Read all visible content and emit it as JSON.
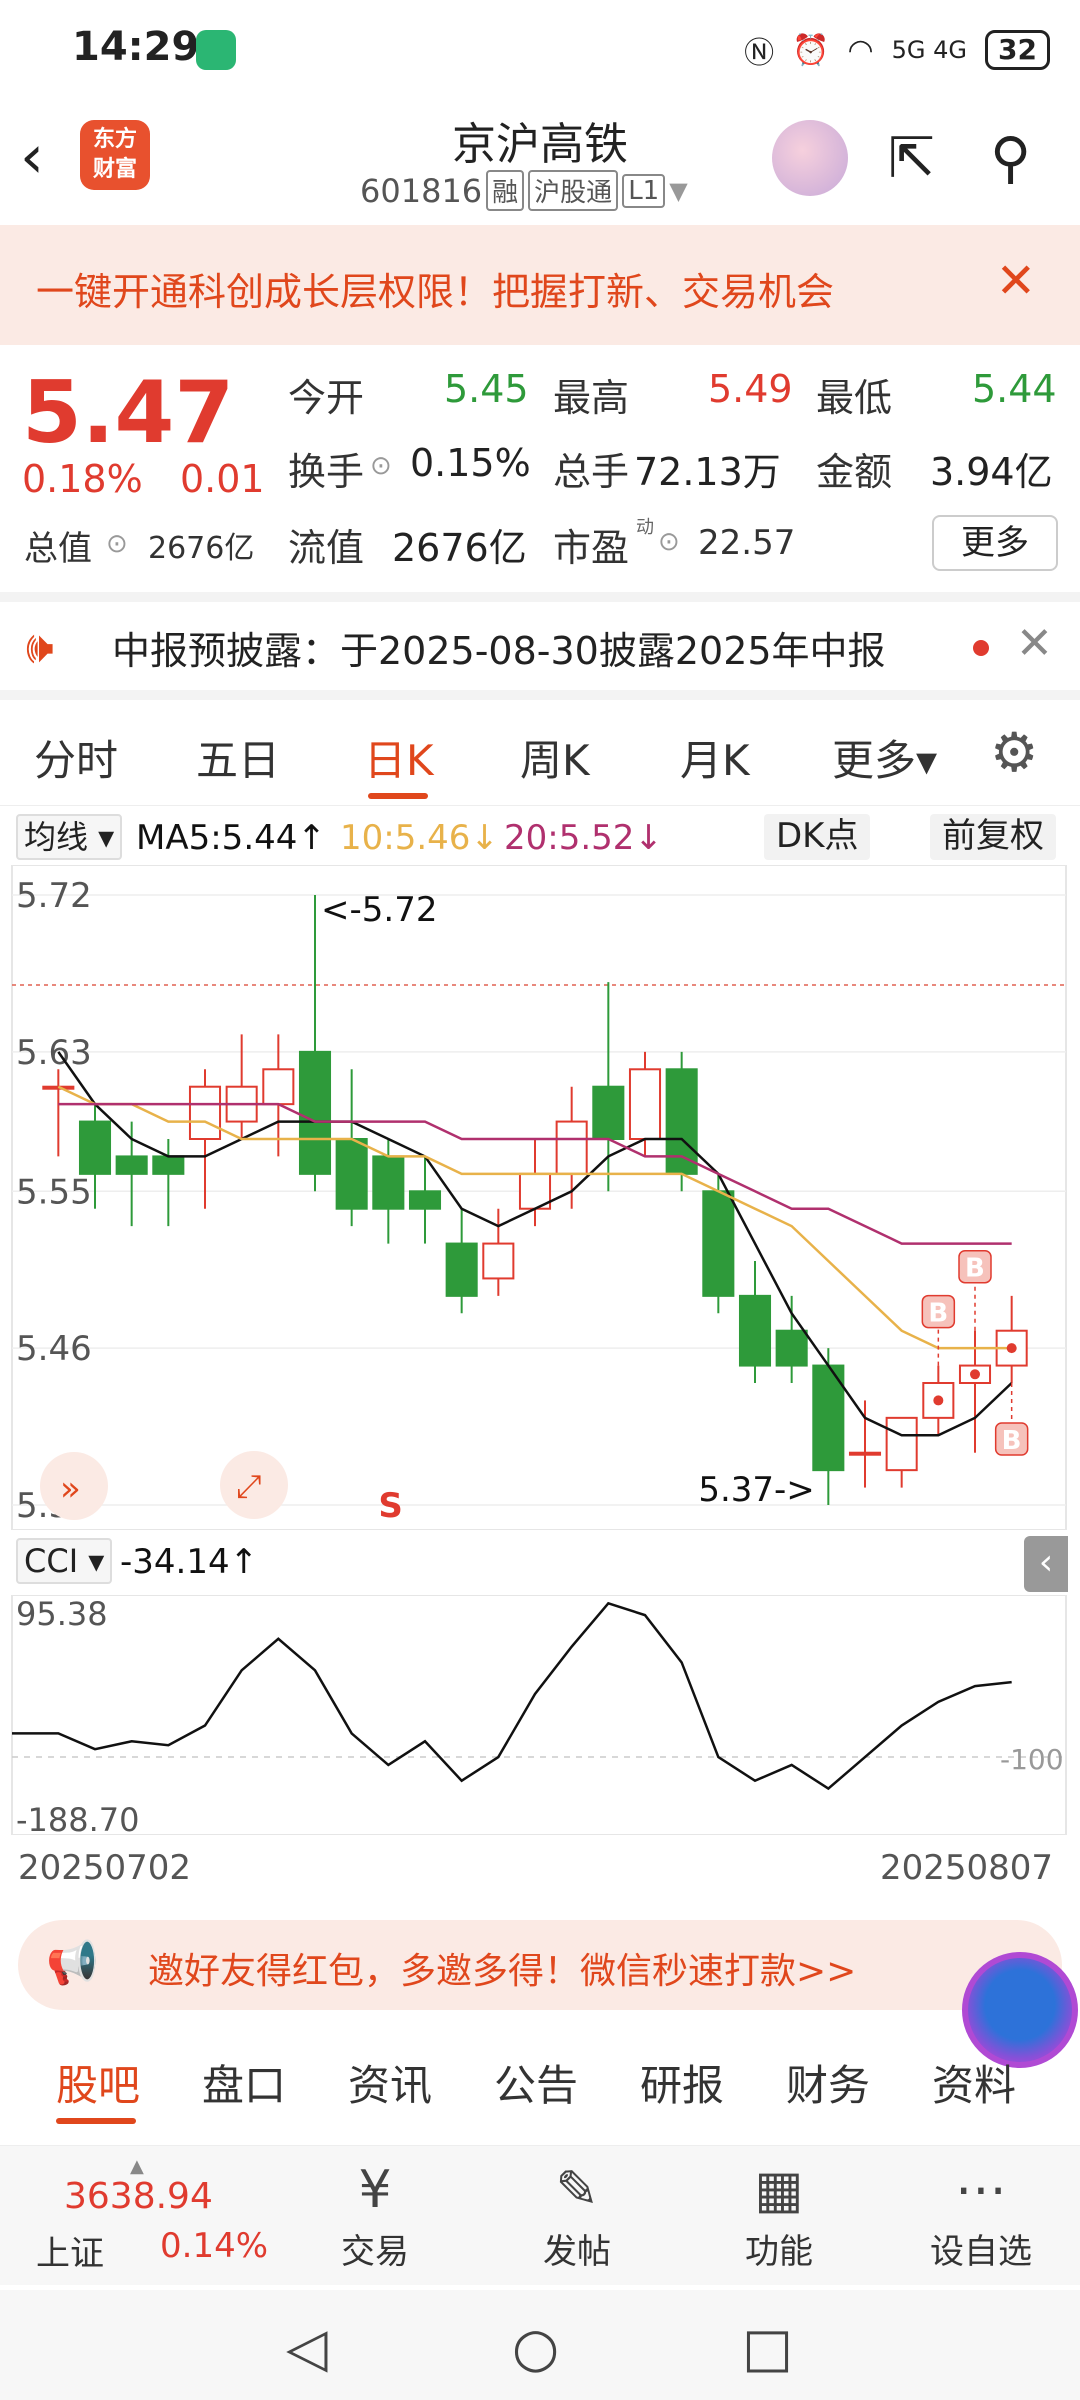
{
  "status_bar": {
    "time": "14:29",
    "network": "5G 4G",
    "battery": "32"
  },
  "header": {
    "logo": "东方\n财富",
    "stock_name": "京沪高铁",
    "stock_code": "601816",
    "tags": [
      "融",
      "沪股通",
      "L1"
    ]
  },
  "promo": {
    "text": "一键开通科创成长层权限！把握打新、交易机会",
    "close": "✕"
  },
  "quote": {
    "price": "5.47",
    "change_pct": "0.18%",
    "change": "0.01",
    "open_label": "今开",
    "open": "5.45",
    "high_label": "最高",
    "high": "5.49",
    "low_label": "最低",
    "low": "5.44",
    "turnover_label": "换手",
    "turnover": "0.15%",
    "volume_label": "总手",
    "volume": "72.13万",
    "amount_label": "金额",
    "amount": "3.94亿",
    "total_mv_label": "总值",
    "total_mv": "2676亿",
    "float_mv_label": "流值",
    "float_mv": "2676亿",
    "pe_label": "市盈",
    "pe_sup": "动",
    "pe": "22.57",
    "more": "更多"
  },
  "notice": {
    "text": "中报预披露：于2025-08-30披露2025年中报",
    "close": "✕"
  },
  "period_tabs": [
    "分时",
    "五日",
    "日K",
    "周K",
    "月K",
    "更多▾"
  ],
  "chart_bar": {
    "ma_select": "均线 ▾",
    "ma5": "MA5:5.44↑",
    "ma10": "10:5.46↓",
    "ma20": "20:5.52↓",
    "dk": "DK点",
    "adjust": "前复权"
  },
  "colors": {
    "up": "#e03b2f",
    "down": "#2e9a3a",
    "accent": "#e0471c",
    "ma5": "#111111",
    "ma10": "#e8b24a",
    "ma20": "#b0306e"
  },
  "chart_data": [
    {
      "type": "candlestick",
      "y_ticks": [
        "5.72",
        "5.63",
        "5.55",
        "5.46",
        "5.37"
      ],
      "ylim": [
        5.37,
        5.72
      ],
      "high_label": "<-5.72",
      "low_label": "5.37->",
      "x_start": "20250702",
      "x_end": "20250807",
      "candles": [
        {
          "o": 5.61,
          "c": 5.61,
          "h": 5.62,
          "l": 5.57
        },
        {
          "o": 5.59,
          "c": 5.56,
          "h": 5.6,
          "l": 5.54
        },
        {
          "o": 5.57,
          "c": 5.56,
          "h": 5.59,
          "l": 5.53
        },
        {
          "o": 5.57,
          "c": 5.56,
          "h": 5.58,
          "l": 5.53
        },
        {
          "o": 5.58,
          "c": 5.61,
          "h": 5.62,
          "l": 5.54
        },
        {
          "o": 5.59,
          "c": 5.61,
          "h": 5.64,
          "l": 5.58
        },
        {
          "o": 5.6,
          "c": 5.62,
          "h": 5.64,
          "l": 5.57
        },
        {
          "o": 5.63,
          "c": 5.56,
          "h": 5.72,
          "l": 5.55
        },
        {
          "o": 5.58,
          "c": 5.54,
          "h": 5.62,
          "l": 5.53
        },
        {
          "o": 5.57,
          "c": 5.54,
          "h": 5.58,
          "l": 5.52
        },
        {
          "o": 5.55,
          "c": 5.54,
          "h": 5.57,
          "l": 5.52
        },
        {
          "o": 5.52,
          "c": 5.49,
          "h": 5.54,
          "l": 5.48
        },
        {
          "o": 5.5,
          "c": 5.52,
          "h": 5.54,
          "l": 5.49
        },
        {
          "o": 5.54,
          "c": 5.56,
          "h": 5.58,
          "l": 5.53
        },
        {
          "o": 5.56,
          "c": 5.59,
          "h": 5.61,
          "l": 5.54
        },
        {
          "o": 5.61,
          "c": 5.58,
          "h": 5.67,
          "l": 5.55
        },
        {
          "o": 5.58,
          "c": 5.62,
          "h": 5.63,
          "l": 5.57
        },
        {
          "o": 5.62,
          "c": 5.56,
          "h": 5.63,
          "l": 5.55
        },
        {
          "o": 5.55,
          "c": 5.49,
          "h": 5.56,
          "l": 5.48
        },
        {
          "o": 5.49,
          "c": 5.45,
          "h": 5.51,
          "l": 5.44
        },
        {
          "o": 5.47,
          "c": 5.45,
          "h": 5.49,
          "l": 5.44
        },
        {
          "o": 5.45,
          "c": 5.39,
          "h": 5.46,
          "l": 5.37
        },
        {
          "o": 5.4,
          "c": 5.4,
          "h": 5.43,
          "l": 5.38
        },
        {
          "o": 5.39,
          "c": 5.42,
          "h": 5.42,
          "l": 5.38
        },
        {
          "o": 5.42,
          "c": 5.44,
          "h": 5.45,
          "l": 5.41
        },
        {
          "o": 5.44,
          "c": 5.45,
          "h": 5.47,
          "l": 5.4
        },
        {
          "o": 5.45,
          "c": 5.47,
          "h": 5.49,
          "l": 5.44
        }
      ],
      "series": [
        {
          "name": "MA5",
          "values": [
            5.63,
            5.6,
            5.58,
            5.57,
            5.57,
            5.58,
            5.59,
            5.59,
            5.59,
            5.58,
            5.57,
            5.54,
            5.53,
            5.54,
            5.55,
            5.57,
            5.58,
            5.58,
            5.56,
            5.52,
            5.48,
            5.45,
            5.42,
            5.41,
            5.41,
            5.42,
            5.44
          ]
        },
        {
          "name": "10",
          "values": [
            5.61,
            5.6,
            5.6,
            5.59,
            5.59,
            5.58,
            5.58,
            5.58,
            5.58,
            5.57,
            5.57,
            5.56,
            5.56,
            5.56,
            5.56,
            5.56,
            5.56,
            5.56,
            5.55,
            5.54,
            5.53,
            5.51,
            5.49,
            5.47,
            5.46,
            5.46,
            5.46
          ]
        },
        {
          "name": "20",
          "values": [
            5.6,
            5.6,
            5.6,
            5.6,
            5.6,
            5.6,
            5.6,
            5.59,
            5.59,
            5.59,
            5.59,
            5.58,
            5.58,
            5.58,
            5.58,
            5.58,
            5.57,
            5.57,
            5.56,
            5.55,
            5.54,
            5.54,
            5.53,
            5.52,
            5.52,
            5.52,
            5.52
          ]
        }
      ],
      "markers": [
        {
          "index": 24,
          "label": "B",
          "pos": "above"
        },
        {
          "index": 25,
          "label": "B",
          "pos": "above"
        },
        {
          "index": 26,
          "label": "B",
          "pos": "below"
        },
        {
          "index": 9,
          "label": "S",
          "pos": "bottom"
        }
      ]
    },
    {
      "type": "line",
      "name": "CCI",
      "value_label": "-34.14↑",
      "y_ticks": [
        "95.38",
        "-100",
        "-188.70"
      ],
      "ylim": [
        -188.7,
        95.38
      ],
      "values": [
        -70,
        -90,
        -80,
        -85,
        -60,
        10,
        50,
        10,
        -70,
        -110,
        -80,
        -130,
        -100,
        -20,
        40,
        95,
        80,
        20,
        -100,
        -130,
        -110,
        -140,
        -100,
        -60,
        -30,
        -10,
        -5
      ]
    }
  ],
  "invite": {
    "text": "邀好友得红包，多邀多得！微信秒速打款>>"
  },
  "bottom_tabs": [
    "股吧",
    "盘口",
    "资讯",
    "公告",
    "研报",
    "财务",
    "资料"
  ],
  "toolbar": {
    "index_value": "3638.94",
    "index_name": "上证",
    "index_pct": "0.14%",
    "tools": [
      {
        "icon": "yen-exchange-icon",
        "label": "交易"
      },
      {
        "icon": "edit-post-icon",
        "label": "发帖"
      },
      {
        "icon": "grid-function-icon",
        "label": "功能"
      },
      {
        "icon": "more-dots-icon",
        "label": "设自选"
      }
    ]
  }
}
